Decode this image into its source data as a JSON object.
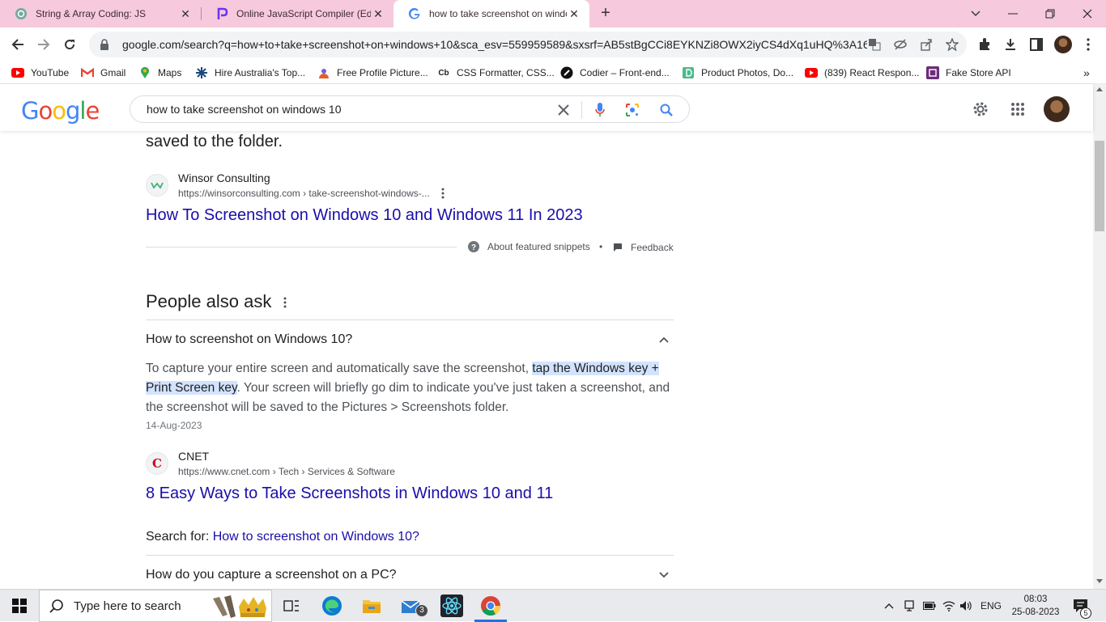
{
  "browser": {
    "tabs": [
      {
        "title": "String & Array Coding: JS",
        "icon": "chatgpt-icon"
      },
      {
        "title": "Online JavaScript Compiler (Edito",
        "icon": "programiz-icon"
      },
      {
        "title": "how to take screenshot on windo",
        "icon": "google-g-icon",
        "active": true
      }
    ],
    "url": "google.com/search?q=how+to+take+screenshot+on+windows+10&sca_esv=559959589&sxsrf=AB5stBgCCi8EYKNZi8OWX2iyCS4dXq1uHQ%3A16...",
    "bookmarks": [
      {
        "label": "YouTube",
        "icon": "youtube-icon"
      },
      {
        "label": "Gmail",
        "icon": "gmail-icon"
      },
      {
        "label": "Maps",
        "icon": "maps-icon"
      },
      {
        "label": "Hire Australia's Top...",
        "icon": "star-logo-icon"
      },
      {
        "label": "Free Profile Picture...",
        "icon": "profile-picture-icon"
      },
      {
        "label": "CSS Formatter, CSS...",
        "icon": "cb-icon"
      },
      {
        "label": "Codier – Front-end...",
        "icon": "codier-icon"
      },
      {
        "label": "Product Photos, Do...",
        "icon": "product-photos-icon"
      },
      {
        "label": "(839) React Respon...",
        "icon": "youtube-icon"
      },
      {
        "label": "Fake Store API",
        "icon": "fake-store-icon"
      }
    ]
  },
  "google": {
    "logo_letters": [
      "G",
      "o",
      "o",
      "g",
      "l",
      "e"
    ],
    "logo_colors": [
      "#4285F4",
      "#EA4335",
      "#FBBC05",
      "#4285F4",
      "#34A853",
      "#EA4335"
    ],
    "query": "how to take screenshot on windows 10"
  },
  "results": {
    "snippet_tail": "saved to the folder.",
    "featured": {
      "source_name": "Winsor Consulting",
      "source_url": "https://winsorconsulting.com › take-screenshot-windows-...",
      "title": "How To Screenshot on Windows 10 and Windows 11 In 2023",
      "about_label": "About featured snippets",
      "separator": "•",
      "feedback_label": "Feedback"
    },
    "paa": {
      "heading": "People also ask",
      "questions": [
        {
          "question": "How to screenshot on Windows 10?",
          "expanded": true,
          "answer_before": "To capture your entire screen and automatically save the screenshot, ",
          "answer_highlight": "tap the Windows key + Print Screen key",
          "answer_after": ". Your screen will briefly go dim to indicate you've just taken a screenshot, and the screenshot will be saved to the Pictures > Screenshots folder.",
          "date": "14-Aug-2023",
          "source_name": "CNET",
          "source_url": "https://www.cnet.com › Tech › Services & Software",
          "title": "8 Easy Ways to Take Screenshots in Windows 10 and 11",
          "search_for_label": "Search for: ",
          "search_for_link": "How to screenshot on Windows 10?"
        },
        {
          "question": "How do you capture a screenshot on a PC?",
          "expanded": false
        }
      ]
    }
  },
  "taskbar": {
    "search_placeholder": "Type here to search",
    "apps": [
      "task-view-icon",
      "edge-icon",
      "file-explorer-icon",
      "mail-icon",
      "react-icon",
      "chrome-icon"
    ],
    "mail_badge": "3",
    "language": "ENG",
    "time": "08:03",
    "date": "25-08-2023",
    "notification_count": "5"
  }
}
